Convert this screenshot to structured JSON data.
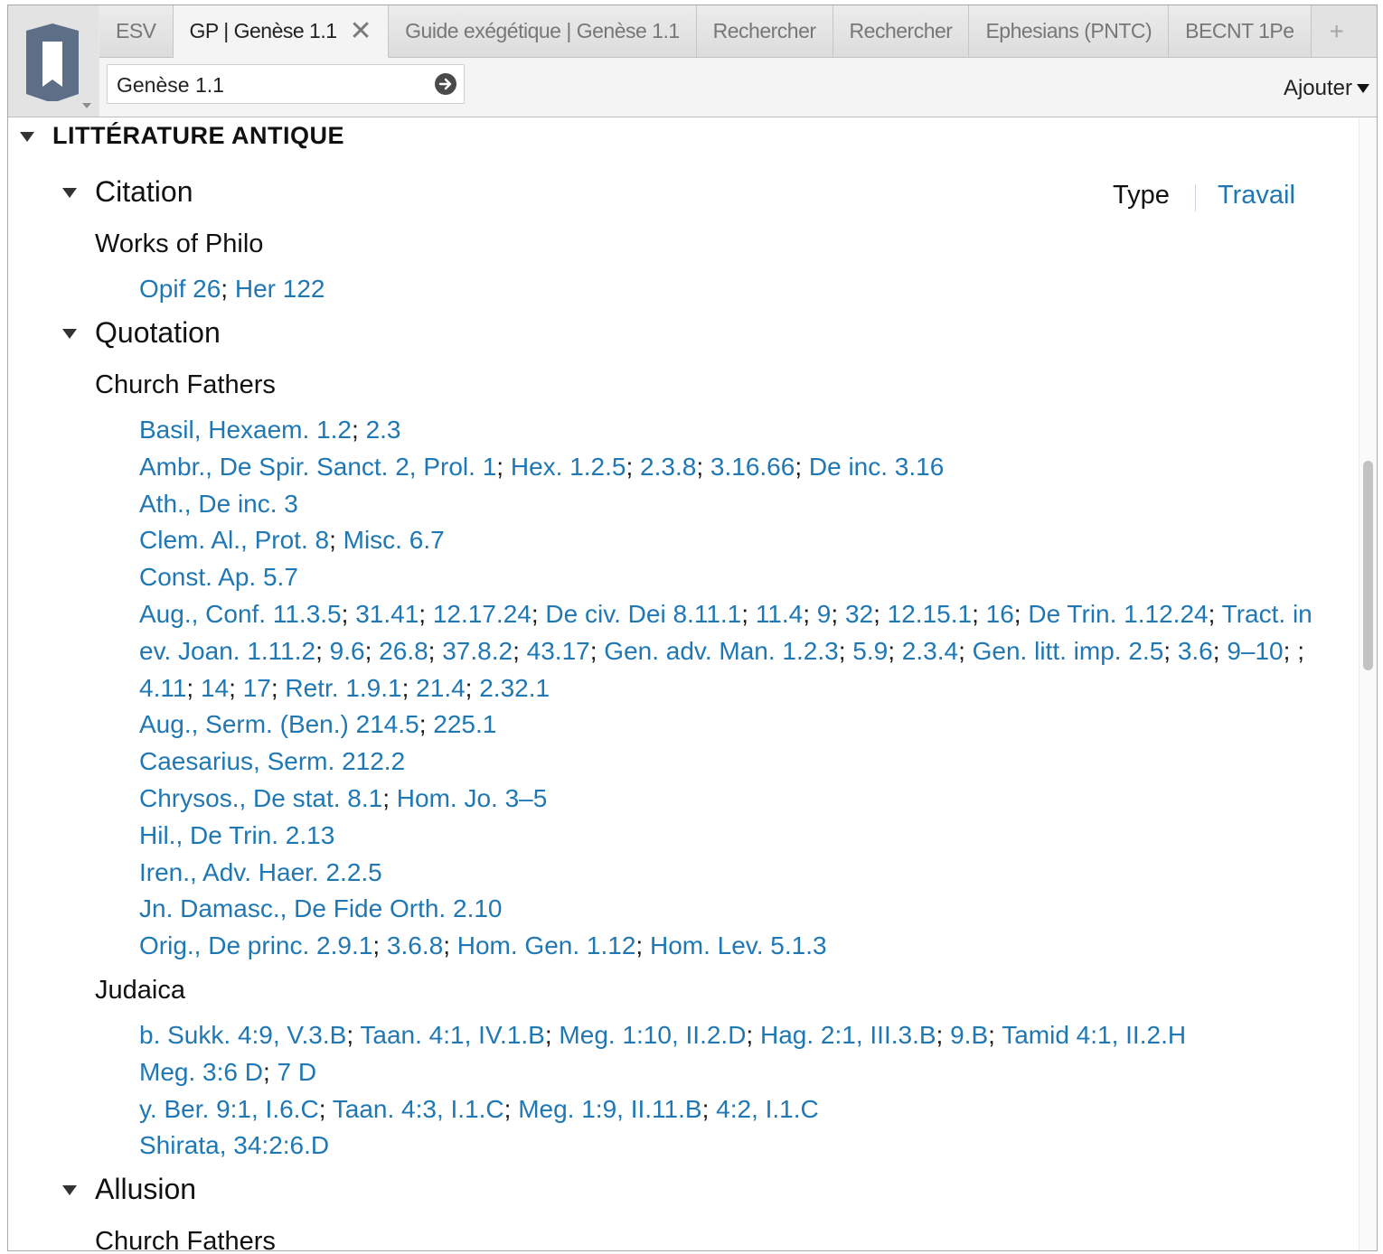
{
  "tabs": [
    {
      "label": "ESV",
      "active": false
    },
    {
      "label": "GP | Genèse 1.1",
      "active": true
    },
    {
      "label": "Guide exégétique | Genèse 1.1",
      "active": false
    },
    {
      "label": "Rechercher",
      "active": false
    },
    {
      "label": "Rechercher",
      "active": false
    },
    {
      "label": "Ephesians (PNTC)",
      "active": false
    },
    {
      "label": "BECNT 1Pe",
      "active": false
    }
  ],
  "tab_close_glyph": "✕",
  "tab_add_glyph": "+",
  "reference": {
    "value": "Genèse 1.1"
  },
  "toolbar": {
    "add_label": "Ajouter"
  },
  "section": {
    "title": "LITTÉRATURE ANTIQUE"
  },
  "view_toggle": {
    "type_label": "Type",
    "work_label": "Travail"
  },
  "citation": {
    "heading": "Citation",
    "group": "Works of Philo",
    "lines": [
      [
        "Opif 26",
        "Her 122"
      ]
    ]
  },
  "quotation": {
    "heading": "Quotation",
    "church_fathers": {
      "group": "Church Fathers",
      "lines": [
        [
          "Basil, Hexaem. 1.2",
          "2.3"
        ],
        [
          "Ambr., De Spir. Sanct. 2, Prol. 1",
          "Hex. 1.2.5",
          "2.3.8",
          "3.16.66",
          "De inc. 3.16"
        ],
        [
          "Ath., De inc. 3"
        ],
        [
          "Clem. Al., Prot. 8",
          "Misc. 6.7"
        ],
        [
          "Const. Ap. 5.7"
        ],
        [
          "Aug., Conf. 11.3.5",
          "31.41",
          "12.17.24",
          "De civ. Dei 8.11.1",
          "11.4",
          "9",
          "32",
          "12.15.1",
          "16",
          "De Trin. 1.12.24",
          "Tract. in"
        ],
        [
          "ev. Joan. 1.11.2",
          "9.6",
          "26.8",
          "37.8.2",
          "43.17",
          "Gen. adv. Man. 1.2.3",
          "5.9",
          "2.3.4",
          "Gen. litt. imp. 2.5",
          "3.6",
          "9–10",
          ""
        ],
        [
          "4.11",
          "14",
          "17",
          "Retr. 1.9.1",
          "21.4",
          "2.32.1"
        ],
        [
          "Aug., Serm. (Ben.) 214.5",
          "225.1"
        ],
        [
          "Caesarius, Serm. 212.2"
        ],
        [
          "Chrysos., De stat. 8.1",
          "Hom. Jo. 3–5"
        ],
        [
          "Hil., De Trin. 2.13"
        ],
        [
          "Iren., Adv. Haer. 2.2.5"
        ],
        [
          "Jn. Damasc., De Fide Orth. 2.10"
        ],
        [
          "Orig., De princ. 2.9.1",
          "3.6.8",
          "Hom. Gen. 1.12",
          "Hom. Lev. 5.1.3"
        ]
      ]
    },
    "judaica": {
      "group": "Judaica",
      "lines": [
        [
          "b. Sukk. 4:9, V.3.B",
          "Taan. 4:1, IV.1.B",
          "Meg. 1:10, II.2.D",
          "Hag. 2:1, III.3.B",
          "9.B",
          "Tamid 4:1, II.2.H"
        ],
        [
          "Meg. 3:6 D",
          "7 D"
        ],
        [
          "y. Ber. 9:1, I.6.C",
          "Taan. 4:3, I.1.C",
          "Meg. 1:9, II.11.B",
          "4:2, I.1.C"
        ],
        [
          "Shirata, 34:2:6.D"
        ]
      ]
    }
  },
  "allusion": {
    "heading": "Allusion",
    "group": "Church Fathers"
  },
  "separator": "; ",
  "colors": {
    "link": "#1f78b4",
    "text": "#1b1b1b",
    "chrome": "#e8e8e8",
    "logo": "#5d6f86"
  }
}
